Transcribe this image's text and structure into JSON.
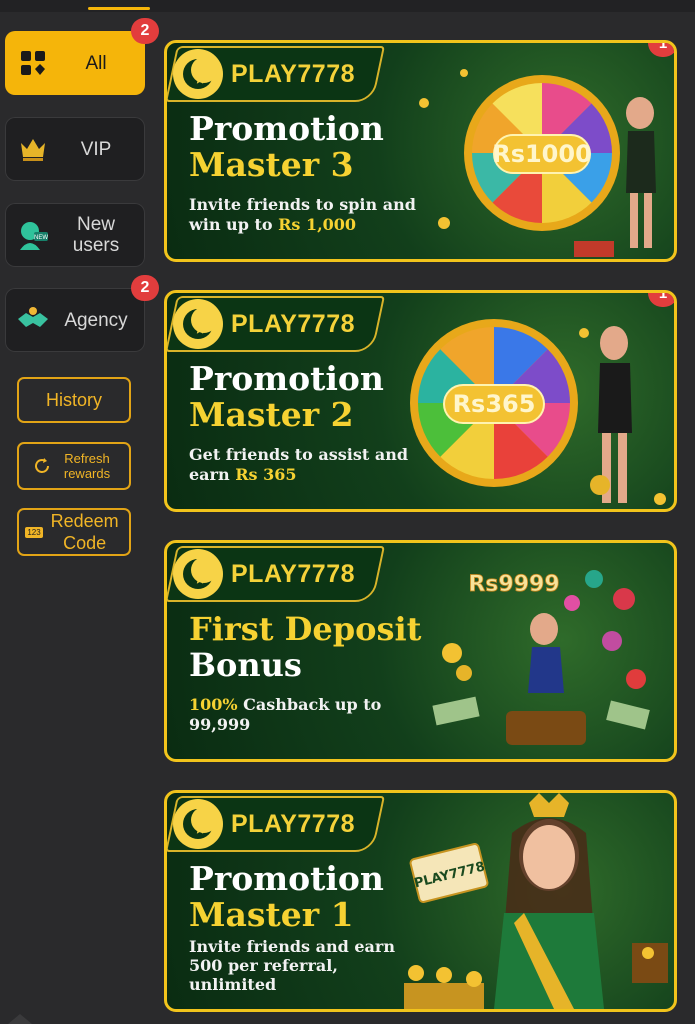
{
  "sidebar": {
    "items": [
      {
        "label": "All",
        "badge": "2",
        "icon": "grid-icon"
      },
      {
        "label": "VIP",
        "icon": "crown-icon"
      },
      {
        "label": "New users",
        "icon": "new-user-icon"
      },
      {
        "label": "Agency",
        "badge": "2",
        "icon": "handshake-icon"
      }
    ],
    "history_label": "History",
    "refresh_label": "Refresh rewards",
    "redeem_label": "Redeem Code",
    "redeem_icon_text": "123"
  },
  "promos": [
    {
      "brand": "PLAY7778",
      "badge": "1",
      "title_line1": "Promotion",
      "title_line2": "Master 3",
      "desc_a": "Invite friends to spin and",
      "desc_b": "win up to ",
      "desc_hl": "Rs 1,000",
      "art_amount": "Rs1000"
    },
    {
      "brand": "PLAY7778",
      "badge": "1",
      "title_line1": "Promotion",
      "title_line2": "Master 2",
      "desc_a": "Get friends to assist and",
      "desc_b": "earn ",
      "desc_hl": "Rs 365",
      "art_amount": "Rs365"
    },
    {
      "brand": "PLAY7778",
      "title_line1": "First Deposit",
      "title_line2": "Bonus",
      "desc_hl": "100%",
      "desc_a": " Cashback up to",
      "desc_b": "99,999",
      "art_amount": "Rs9999"
    },
    {
      "brand": "PLAY7778",
      "title_line1": "Promotion",
      "title_line2": "Master 1",
      "desc_a": "Invite friends and earn",
      "desc_b": "500 per referral,",
      "desc_c": "unlimited",
      "art_card_text": "PLAY7778"
    }
  ],
  "colors": {
    "accent": "#f5b50a",
    "badge": "#e23d3d",
    "card_border": "#f2c41c",
    "highlight_text": "#f6d232"
  }
}
